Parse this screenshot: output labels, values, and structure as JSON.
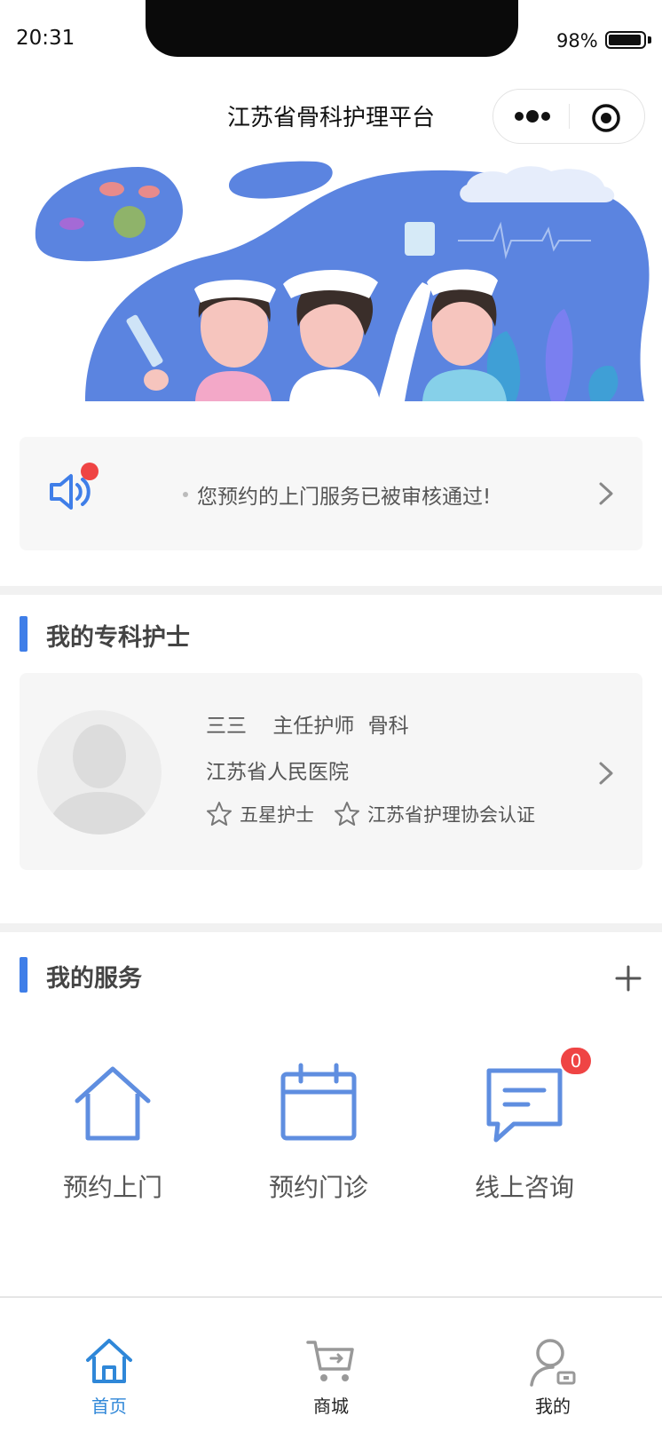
{
  "status_bar": {
    "time": "20:31",
    "battery": "98%"
  },
  "header": {
    "title": "江苏省骨科护理平台"
  },
  "notice": {
    "text": "您预约的上门服务已被审核通过!"
  },
  "nurse_section": {
    "title": "我的专科护士",
    "nurse": {
      "name": "三三",
      "position": "主任护师",
      "department": "骨科",
      "hospital": "江苏省人民医院",
      "tags": [
        "五星护士",
        "江苏省护理协会认证"
      ]
    }
  },
  "service_section": {
    "title": "我的服务",
    "items": [
      {
        "label": "预约上门",
        "icon": "house-icon"
      },
      {
        "label": "预约门诊",
        "icon": "calendar-icon"
      },
      {
        "label": "线上咨询",
        "icon": "chat-icon",
        "badge": "0"
      }
    ]
  },
  "tabbar": {
    "items": [
      {
        "label": "首页",
        "icon": "home-icon",
        "active": true
      },
      {
        "label": "商城",
        "icon": "cart-icon",
        "active": false
      },
      {
        "label": "我的",
        "icon": "user-icon",
        "active": false
      }
    ]
  },
  "colors": {
    "accent": "#3f7ee8",
    "tab_active": "#2f87d8",
    "badge": "#ef4444",
    "icon_blue": "#5f8ee0"
  }
}
